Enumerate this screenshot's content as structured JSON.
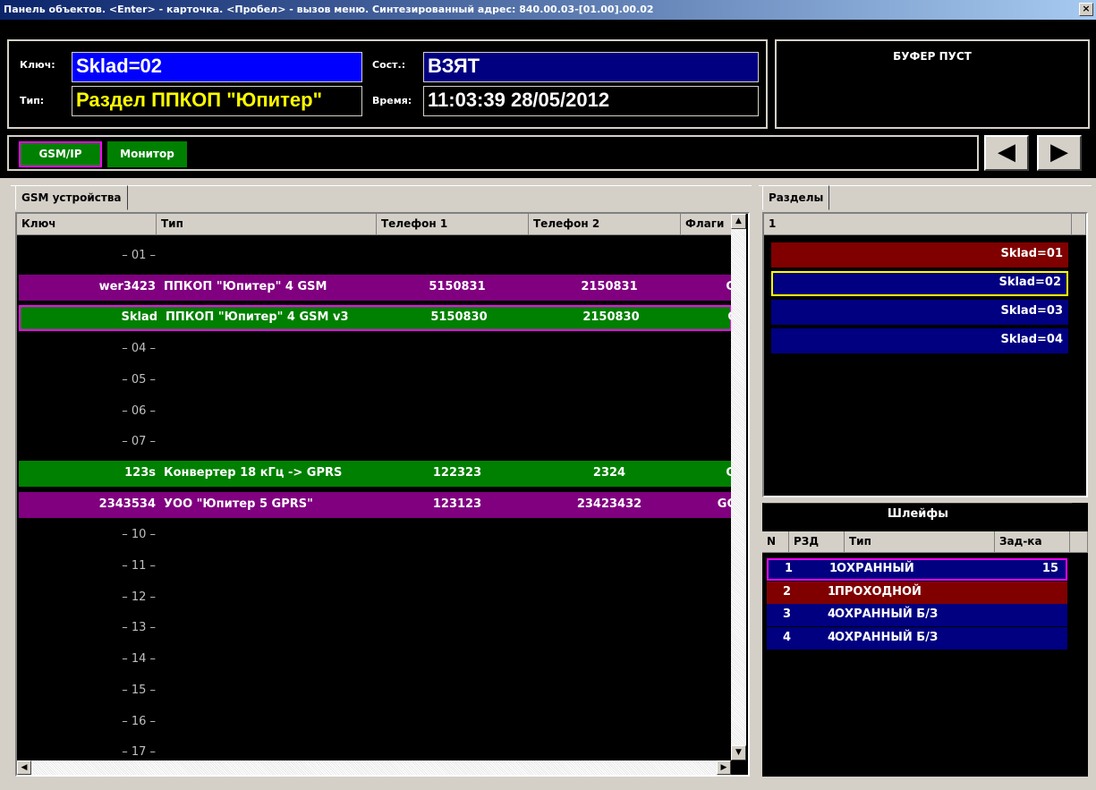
{
  "window": {
    "title": "Панель объектов. <Enter> - карточка. <Пробел> - вызов меню. Синтезированный адрес: 840.00.03-[01.00].00.02",
    "close_label": "×"
  },
  "info": {
    "key_label": "Ключ:",
    "key_value": "Sklad=02",
    "type_label": "Тип:",
    "type_value": "Раздел ППКОП \"Юпитер\"",
    "state_label": "Сост.:",
    "state_value": "ВЗЯТ",
    "time_label": "Время:",
    "time_value": "11:03:39 28/05/2012"
  },
  "buffer": {
    "text": "БУФЕР ПУСТ"
  },
  "mode_buttons": [
    {
      "label": "GSM/IP"
    },
    {
      "label": "Монитор"
    }
  ],
  "nav": {
    "prev_icon": "◀",
    "next_icon": "▶"
  },
  "devices_tab": {
    "label": "GSM устройства"
  },
  "grid": {
    "columns": [
      "Ключ",
      "Тип",
      "Телефон 1",
      "Телефон 2",
      "Флаги"
    ],
    "rows": [
      {
        "key": "– 01 –",
        "type": "",
        "phone1": "",
        "phone2": "",
        "flags": ""
      },
      {
        "key": "wer3423",
        "type": "ППКОП \"Юпитер\" 4 GSM",
        "phone1": "5150831",
        "phone2": "2150831",
        "flags": "G"
      },
      {
        "key": "Sklad",
        "type": "ППКОП \"Юпитер\" 4 GSM v3",
        "phone1": "5150830",
        "phone2": "2150830",
        "flags": "G"
      },
      {
        "key": "– 04 –",
        "type": "",
        "phone1": "",
        "phone2": "",
        "flags": ""
      },
      {
        "key": "– 05 –",
        "type": "",
        "phone1": "",
        "phone2": "",
        "flags": ""
      },
      {
        "key": "– 06 –",
        "type": "",
        "phone1": "",
        "phone2": "",
        "flags": ""
      },
      {
        "key": "– 07 –",
        "type": "",
        "phone1": "",
        "phone2": "",
        "flags": ""
      },
      {
        "key": "123s",
        "type": "Конвертер 18 кГц -> GPRS",
        "phone1": "122323",
        "phone2": "2324",
        "flags": "G"
      },
      {
        "key": "2343534",
        "type": "УОО \"Юпитер 5 GPRS\"",
        "phone1": "123123",
        "phone2": "23423432",
        "flags": "GC"
      },
      {
        "key": "– 10 –",
        "type": "",
        "phone1": "",
        "phone2": "",
        "flags": ""
      },
      {
        "key": "– 11 –",
        "type": "",
        "phone1": "",
        "phone2": "",
        "flags": ""
      },
      {
        "key": "– 12 –",
        "type": "",
        "phone1": "",
        "phone2": "",
        "flags": ""
      },
      {
        "key": "– 13 –",
        "type": "",
        "phone1": "",
        "phone2": "",
        "flags": ""
      },
      {
        "key": "– 14 –",
        "type": "",
        "phone1": "",
        "phone2": "",
        "flags": ""
      },
      {
        "key": "– 15 –",
        "type": "",
        "phone1": "",
        "phone2": "",
        "flags": ""
      },
      {
        "key": "– 16 –",
        "type": "",
        "phone1": "",
        "phone2": "",
        "flags": ""
      },
      {
        "key": "– 17 –",
        "type": "",
        "phone1": "",
        "phone2": "",
        "flags": ""
      }
    ]
  },
  "sections_tab": {
    "label": "Разделы"
  },
  "sections": {
    "header": "1",
    "items": [
      {
        "label": "Sklad=01"
      },
      {
        "label": "Sklad=02"
      },
      {
        "label": "Sklad=03"
      },
      {
        "label": "Sklad=04"
      }
    ]
  },
  "loops": {
    "title": "Шлейфы",
    "columns": [
      "N",
      "РЗД",
      "Тип",
      "Зад-ка"
    ],
    "rows": [
      {
        "n": "1",
        "rzd": "1",
        "type": "ОХРАННЫЙ",
        "delay": "15"
      },
      {
        "n": "2",
        "rzd": "1",
        "type": "ПРОХОДНОЙ",
        "delay": ""
      },
      {
        "n": "3",
        "rzd": "4",
        "type": "ОХРАННЫЙ Б/З",
        "delay": ""
      },
      {
        "n": "4",
        "rzd": "4",
        "type": "ОХРАННЫЙ Б/З",
        "delay": ""
      }
    ]
  },
  "colors": {
    "purple": "#800080",
    "green": "#008000",
    "dark_red": "#800000",
    "navy": "#000080",
    "blue": "#0000ff",
    "yellow": "#ffff00",
    "magenta": "#ff00ff"
  }
}
